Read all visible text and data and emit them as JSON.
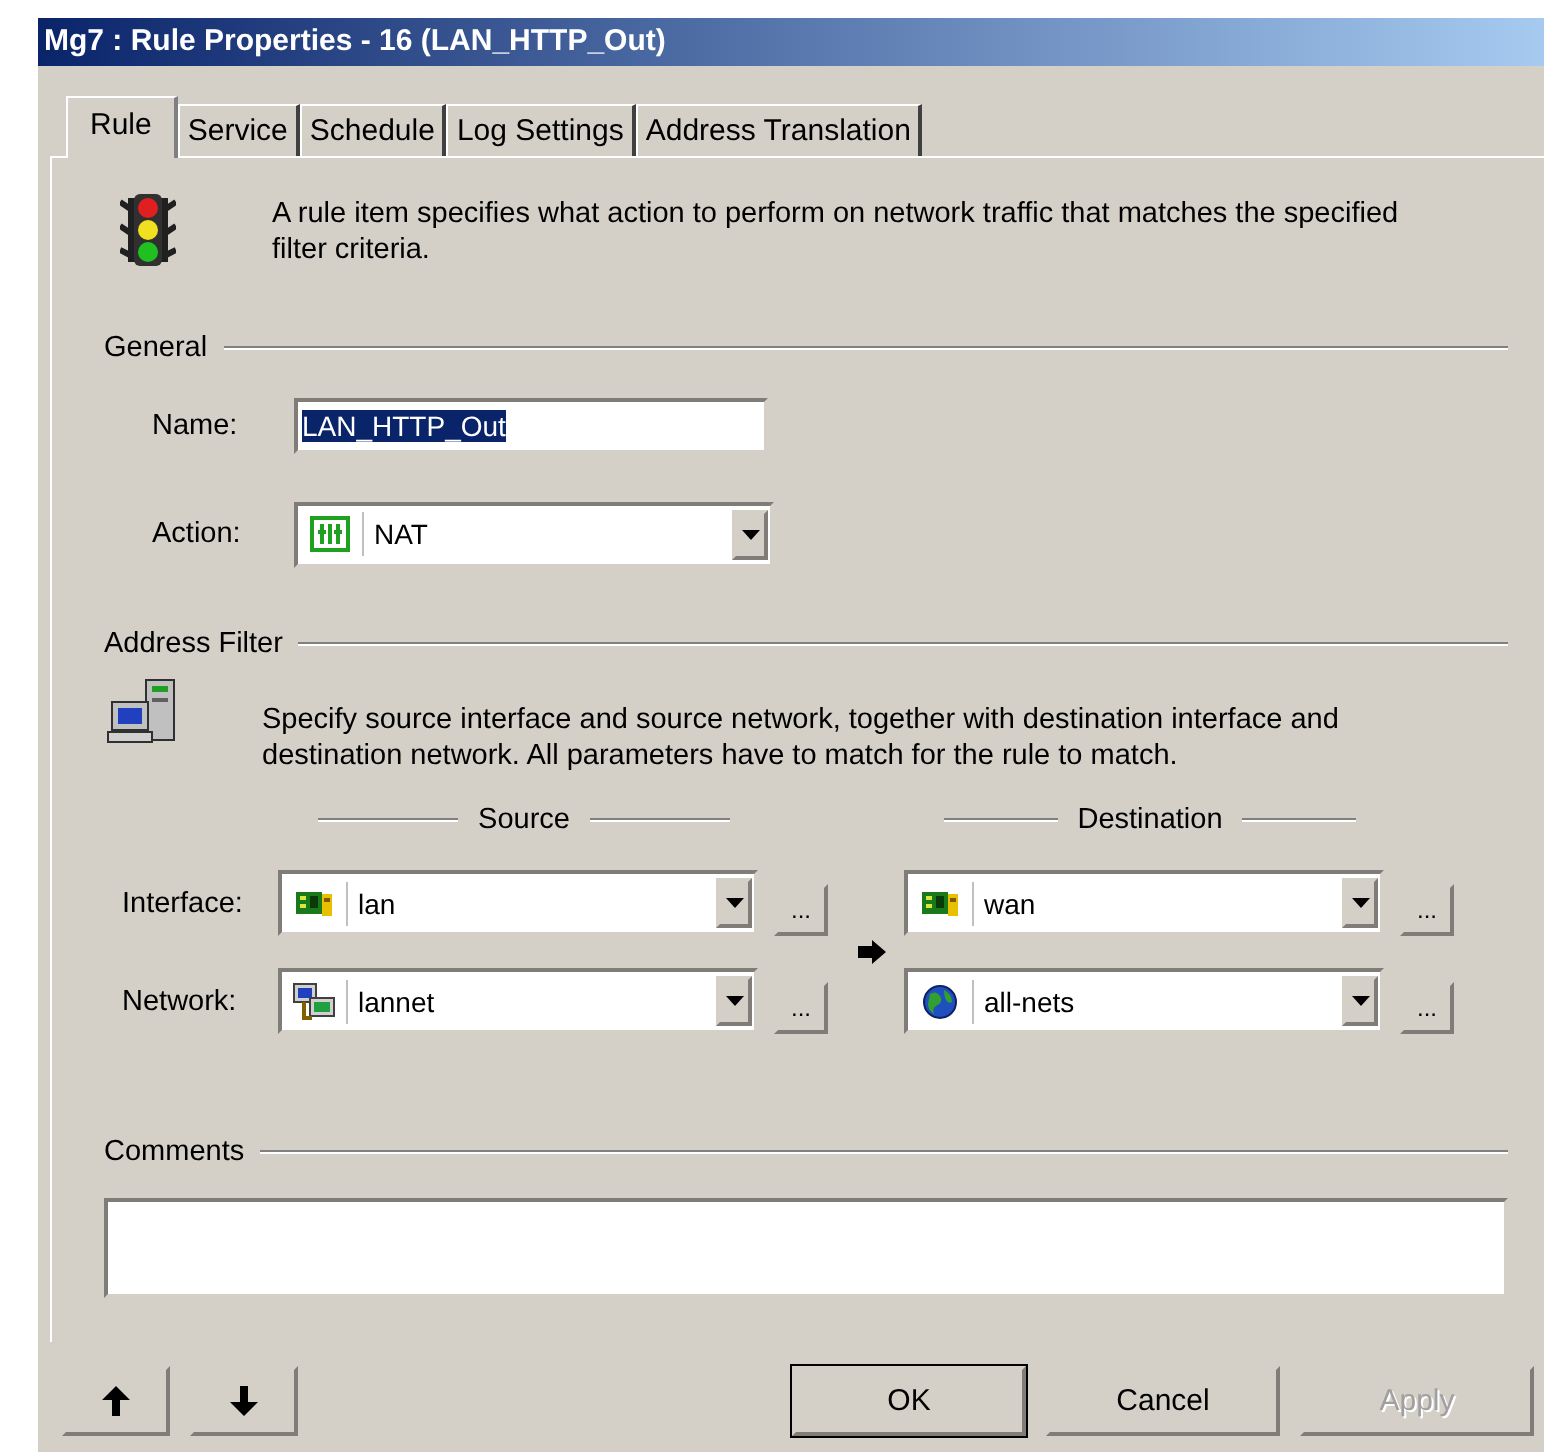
{
  "window": {
    "title": "Mg7 : Rule Properties - 16 (LAN_HTTP_Out)"
  },
  "tabs": [
    {
      "label": "Rule",
      "selected": true
    },
    {
      "label": "Service",
      "selected": false
    },
    {
      "label": "Schedule",
      "selected": false
    },
    {
      "label": "Log Settings",
      "selected": false
    },
    {
      "label": "Address Translation",
      "selected": false
    }
  ],
  "intro": "A rule item specifies what action to perform on network traffic that matches the specified filter criteria.",
  "general": {
    "heading": "General",
    "name": {
      "label": "Name:",
      "value": "LAN_HTTP_Out",
      "text_selected": true
    },
    "action": {
      "label": "Action:",
      "value": "NAT"
    }
  },
  "address_filter": {
    "heading": "Address Filter",
    "description": "Specify source interface and source network, together with destination interface and destination network. All parameters have to match for the rule to match.",
    "source_heading": "Source",
    "destination_heading": "Destination",
    "rows": [
      {
        "label": "Interface:",
        "source": {
          "value": "lan",
          "kind": "interface",
          "browse": "..."
        },
        "destination": {
          "value": "wan",
          "kind": "interface",
          "browse": "..."
        }
      },
      {
        "label": "Network:",
        "source": {
          "value": "lannet",
          "kind": "network",
          "browse": "..."
        },
        "destination": {
          "value": "all-nets",
          "kind": "globe",
          "browse": "..."
        }
      }
    ]
  },
  "comments": {
    "heading": "Comments"
  },
  "buttons": [
    {
      "kind": "up",
      "disabled": false
    },
    {
      "kind": "down",
      "disabled": false
    },
    {
      "kind": "text",
      "label": "OK",
      "disabled": false
    },
    {
      "kind": "text",
      "label": "Cancel",
      "disabled": false
    },
    {
      "kind": "text",
      "label": "Apply",
      "disabled": true
    }
  ]
}
